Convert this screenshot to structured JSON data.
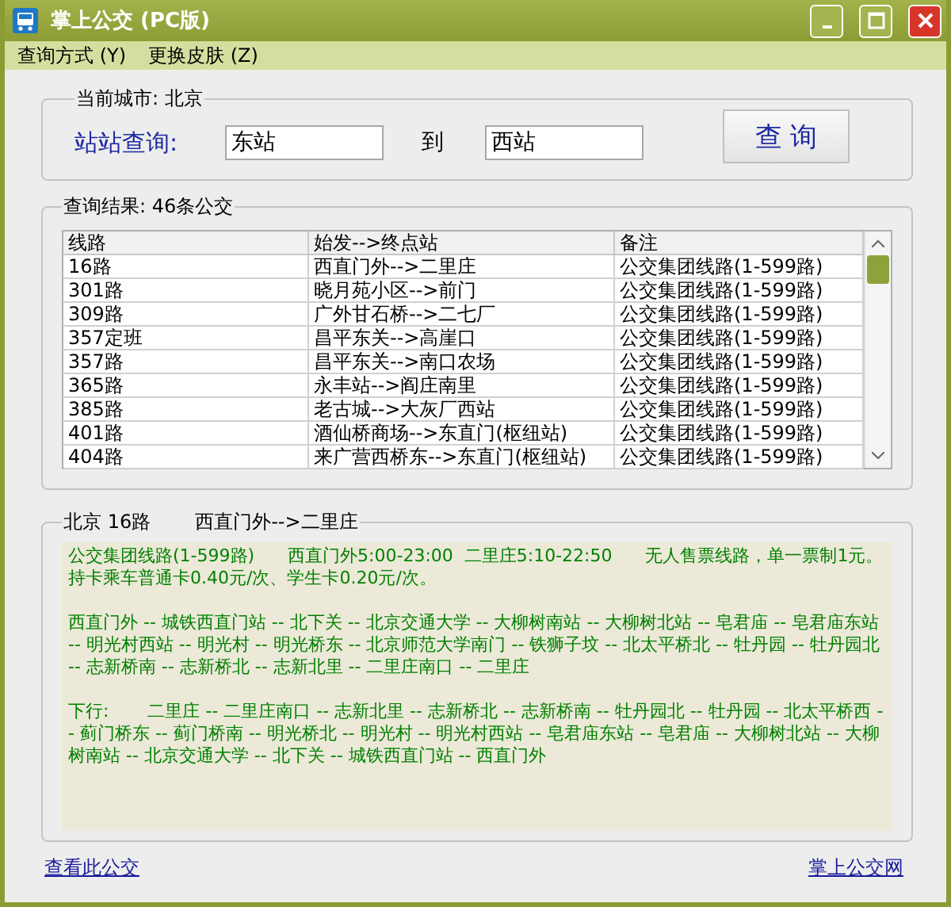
{
  "window": {
    "title": "掌上公交 (PC版)"
  },
  "menu": [
    "查询方式 (Y)",
    "更换皮肤 (Z)"
  ],
  "search_group": {
    "legend": "当前城市: 北京",
    "label": "站站查询:",
    "from": "东站",
    "connector": "到",
    "to": "西站",
    "button": "查 询"
  },
  "results_group": {
    "legend": "查询结果: 46条公交",
    "table": {
      "columns": [
        "线路",
        "始发-->终点站",
        "备注"
      ],
      "rows": [
        [
          "16路",
          "西直门外-->二里庄",
          "公交集团线路(1-599路)"
        ],
        [
          "301路",
          "晓月苑小区-->前门",
          "公交集团线路(1-599路)"
        ],
        [
          "309路",
          "广外甘石桥-->二七厂",
          "公交集团线路(1-599路)"
        ],
        [
          "357定班",
          "昌平东关-->高崖口",
          "公交集团线路(1-599路)"
        ],
        [
          "357路",
          "昌平东关-->南口农场",
          "公交集团线路(1-599路)"
        ],
        [
          "365路",
          "永丰站-->阎庄南里",
          "公交集团线路(1-599路)"
        ],
        [
          "385路",
          "老古城-->大灰厂西站",
          "公交集团线路(1-599路)"
        ],
        [
          "401路",
          "酒仙桥商场-->东直门(枢纽站)",
          "公交集团线路(1-599路)"
        ],
        [
          "404路",
          "来广营西桥东-->东直门(枢纽站)",
          "公交集团线路(1-599路)"
        ]
      ]
    }
  },
  "detail_group": {
    "legend_line": "北京 16路",
    "legend_route": "西直门外-->二里庄",
    "paragraphs": [
      "公交集团线路(1-599路)      西直门外5:00-23:00  二里庄5:10-22:50      无人售票线路，单一票制1元。持卡乘车普通卡0.40元/次、学生卡0.20元/次。",
      "西直门外 -- 城铁西直门站 -- 北下关 -- 北京交通大学 -- 大柳树南站 -- 大柳树北站 -- 皂君庙 -- 皂君庙东站 -- 明光村西站 -- 明光村 -- 明光桥东 -- 北京师范大学南门 -- 铁狮子坟 -- 北太平桥北 -- 牡丹园 -- 牡丹园北 -- 志新桥南 -- 志新桥北 -- 志新北里 -- 二里庄南口 -- 二里庄",
      "下行:       二里庄 -- 二里庄南口 -- 志新北里 -- 志新桥北 -- 志新桥南 -- 牡丹园北 -- 牡丹园 -- 北太平桥西 -- 蓟门桥东 -- 蓟门桥南 -- 明光桥北 -- 明光村 -- 明光村西站 -- 皂君庙东站 -- 皂君庙 -- 大柳树北站 -- 大柳树南站 -- 北京交通大学 -- 北下关 -- 城铁西直门站 -- 西直门外"
    ]
  },
  "footer_links": [
    "查看此公交",
    "掌上公交网"
  ]
}
